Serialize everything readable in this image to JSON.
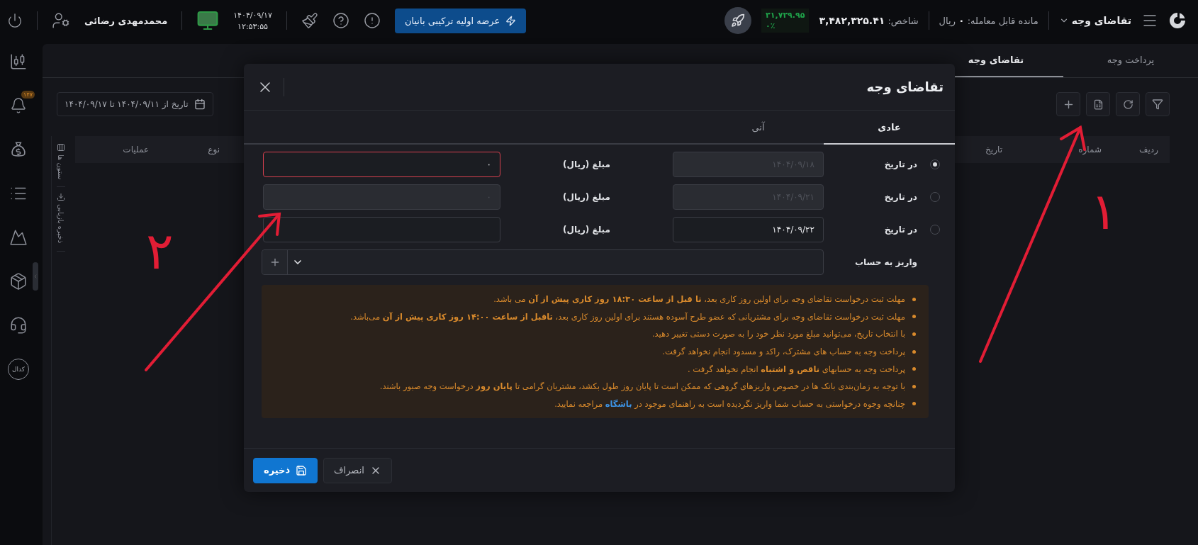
{
  "top_bar": {
    "page_menu": "تقاضای وجه",
    "tradable_balance": "مانده قابل معامله: **۰** ریال",
    "index": "شاخص: **۳,۴۸۲,۳۲۵.۴۱**",
    "index_change": {
      "value": "۳۱,۷۲۹.۹۵",
      "percent": "۰٪"
    },
    "ipo_button": "عرضه اولیه ترکیبی بانیان",
    "date": "۱۴۰۴/۰۹/۱۷",
    "time": "۱۲:۵۳:۵۵",
    "user_name": "محمدمهدی رضائی"
  },
  "sidebar": {
    "notification_badge": "۱۴۷",
    "codal_label": "کدال"
  },
  "page_tabs": [
    {
      "label": "پرداخت وجه",
      "selected": false
    },
    {
      "label": "تقاضای وجه",
      "selected": true
    }
  ],
  "date_range": "تاریخ از ۱۴۰۴/۰۹/۱۱ تا ۱۴۰۴/۰۹/۱۷",
  "table": {
    "columns": [
      "ردیف",
      "شماره",
      "تاریخ",
      "نوع",
      "عملیات"
    ]
  },
  "side_strip": [
    "ستون ها",
    "ذخیره بازیابی"
  ],
  "modal": {
    "title": "تقاضای وجه",
    "tabs": [
      {
        "label": "عادی",
        "selected": true
      },
      {
        "label": "آنی",
        "selected": false
      }
    ],
    "rows": [
      {
        "selected": true,
        "label": "در تاریخ",
        "date": "۱۴۰۴/۰۹/۱۸",
        "date_disabled": true,
        "amount_label": "مبلغ (ریال)",
        "amount": "۰",
        "amount_disabled": false,
        "error": true
      },
      {
        "selected": false,
        "label": "در تاریخ",
        "date": "۱۴۰۴/۰۹/۲۱",
        "date_disabled": true,
        "amount_label": "مبلغ (ریال)",
        "amount": "۰",
        "amount_disabled": true,
        "error": false
      },
      {
        "selected": false,
        "label": "در تاریخ",
        "date": "۱۴۰۴/۰۹/۲۲",
        "date_disabled": false,
        "amount_label": "مبلغ (ریال)",
        "amount_disabled": false,
        "error": false
      }
    ],
    "account": {
      "label": "واریز به حساب"
    },
    "notes": [
      {
        "text": "مهلت ثبت درخواست تقاضای وجه برای اولین روز کاری بعد، **تا قبل از ساعت ۱۸:۳۰ روز کاری پیش از آن** می باشد."
      },
      {
        "text": "مهلت ثبت درخواست تقاضای وجه برای مشتریانی که عضو طرح آسوده هستند برای اولین روز کاری بعد، **تاقبل از ساعت ۱۴:۰۰ روز کاری پیش از آن** می‌باشد."
      },
      {
        "text": "با انتخاب تاریخ، می‌توانید مبلغ مورد نظر خود را به صورت دستی تغییر دهید."
      },
      {
        "text": "پرداخت وجه به حساب های مشترک، راکد و مسدود انجام نخواهد گرفت."
      },
      {
        "text": "پرداخت وجه به حسابهای **ناقص و اشتباه** انجام نخواهد گرفت ."
      },
      {
        "text": "با توجه به زمان‌بندی بانک ها در خصوص واریزهای گروهی که ممکن است تا پایان روز طول بکشد، مشتریان گرامی تا **پایان روز** درخواست وجه صبور باشند."
      },
      {
        "text": "چنانچه وجوه درخواستی به حساب شما واریز نگردیده است به راهنمای موجود در",
        "link": "باشگاه",
        "after": "مراجعه نمایید."
      }
    ],
    "buttons": [
      {
        "label": "انصراف",
        "kind": "secondary"
      },
      {
        "label": "ذخیره",
        "kind": "primary"
      }
    ]
  },
  "annotations": [
    {
      "label": "۱"
    },
    {
      "label": "۲"
    }
  ]
}
